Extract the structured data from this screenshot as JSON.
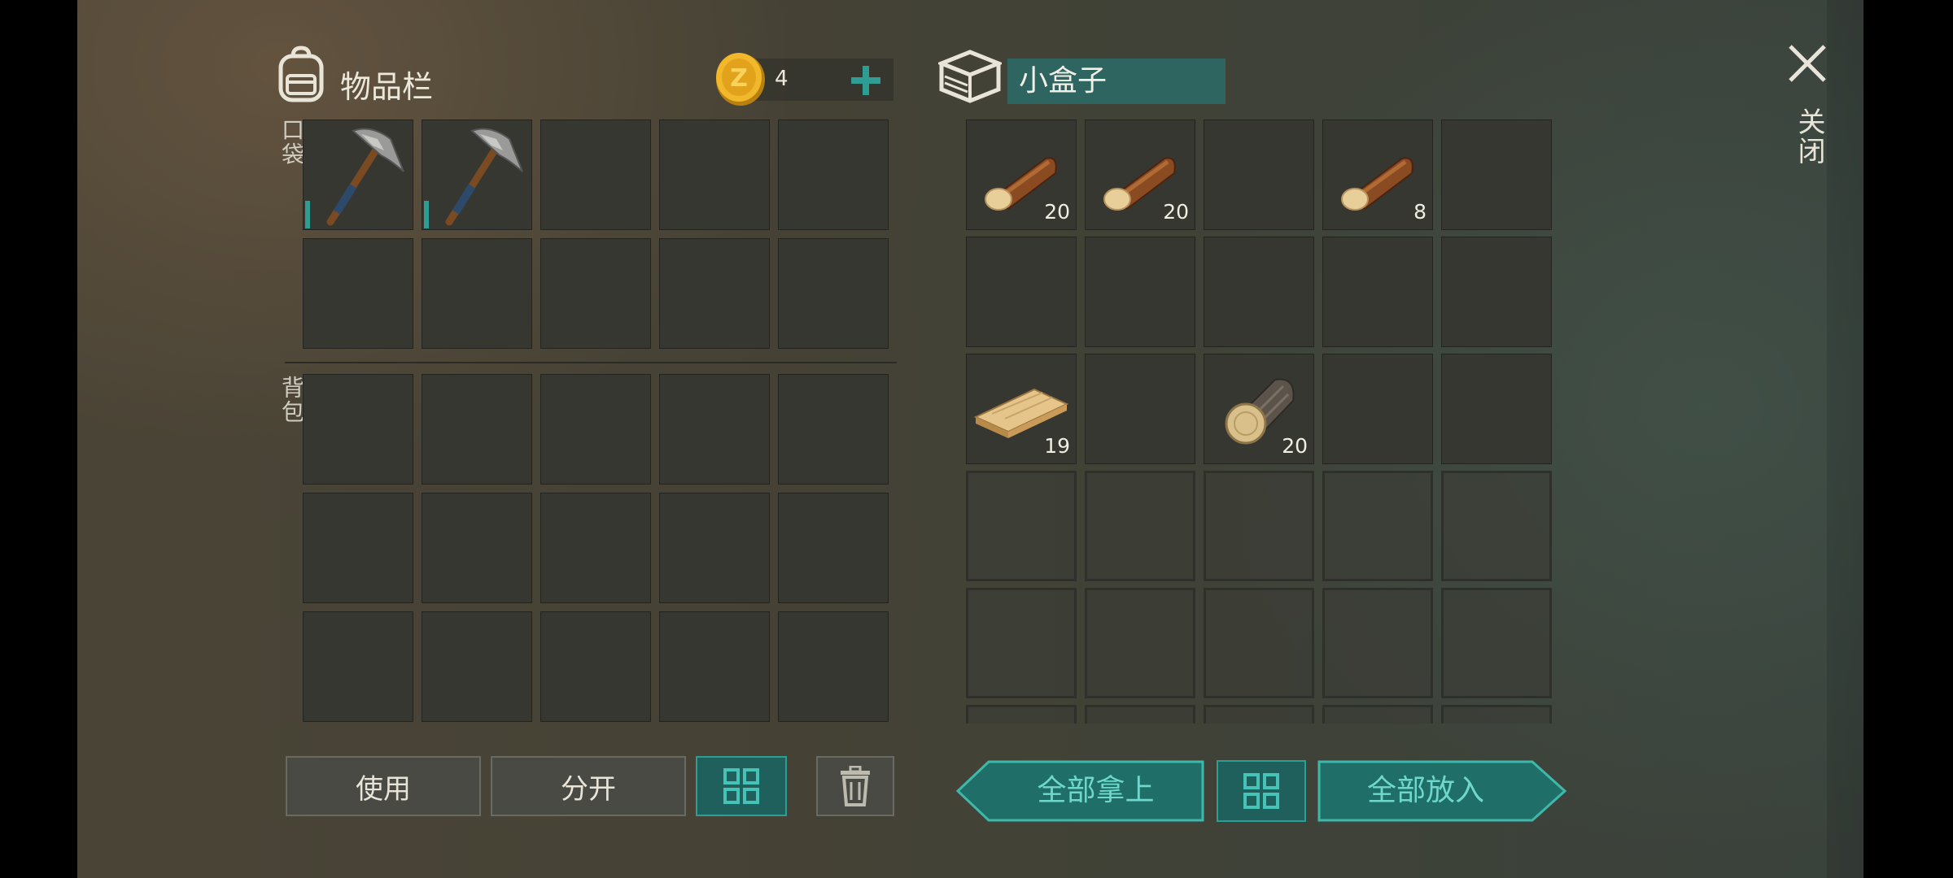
{
  "inventory": {
    "title": "物品栏",
    "coins": "4",
    "section_pocket": "口袋",
    "section_backpack": "背包",
    "pocket_items": [
      {
        "icon": "pickaxe-icon",
        "qty": ""
      },
      {
        "icon": "pickaxe-icon",
        "qty": ""
      }
    ],
    "buttons": {
      "use": "使用",
      "split": "分开"
    }
  },
  "container": {
    "name": "小盒子",
    "items": [
      {
        "icon": "log-icon",
        "qty": "20"
      },
      {
        "icon": "log-icon",
        "qty": "20"
      },
      {
        "icon": "log-icon",
        "qty": "8"
      },
      {
        "icon": "plank-icon",
        "qty": "19"
      },
      {
        "icon": "stump-log-icon",
        "qty": "20"
      }
    ],
    "buttons": {
      "take_all": "全部拿上",
      "put_all": "全部放入"
    }
  },
  "close": {
    "label": "关闭"
  },
  "colors": {
    "accent": "#2e8e88",
    "teal_dark": "#1f5f5c",
    "name_bg": "#2f6560"
  }
}
